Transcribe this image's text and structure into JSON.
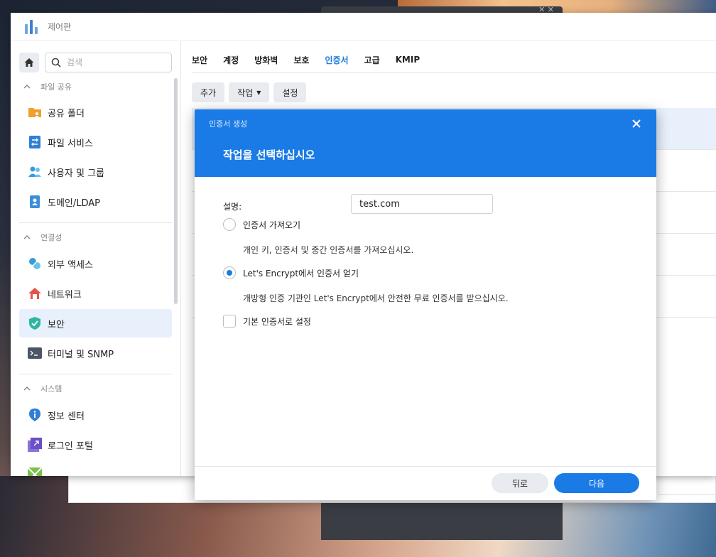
{
  "window": {
    "title": "제어판"
  },
  "sidebar": {
    "search_placeholder": "검색",
    "sections": [
      {
        "label": "파일 공유",
        "items": [
          "공유 폴더",
          "파일 서비스",
          "사용자 및 그룹",
          "도메인/LDAP"
        ]
      },
      {
        "label": "연결성",
        "items": [
          "외부 액세스",
          "네트워크",
          "보안",
          "터미널 및 SNMP"
        ]
      },
      {
        "label": "시스템",
        "items": [
          "정보 센터",
          "로그인 포털"
        ]
      }
    ],
    "active_item": "보안"
  },
  "tabs": [
    "보안",
    "계정",
    "방화벽",
    "보호",
    "인증서",
    "고급",
    "KMIP"
  ],
  "active_tab": "인증서",
  "toolbar": {
    "add": "추가",
    "action": "작업",
    "settings": "설정"
  },
  "modal": {
    "small_title": "인증서 생성",
    "heading": "작업을 선택하십시오",
    "description_label": "설명:",
    "description_value": "test.com",
    "option_import": "인증서 가져오기",
    "option_import_desc": "개인 키, 인증서 및 중간 인증서를 가져오십시오.",
    "option_letsencrypt": "Let's Encrypt에서 인증서 얻기",
    "option_letsencrypt_desc": "개방형 인증 기관인 Let's Encrypt에서 안전한 무료 인증서를 받으십시오.",
    "option_default": "기본 인증서로 설정",
    "selected_option": "letsencrypt",
    "default_checked": false,
    "back": "뒤로",
    "next": "다음"
  },
  "colors": {
    "accent": "#1a7ae6",
    "active_bg": "#e7f0fb"
  }
}
